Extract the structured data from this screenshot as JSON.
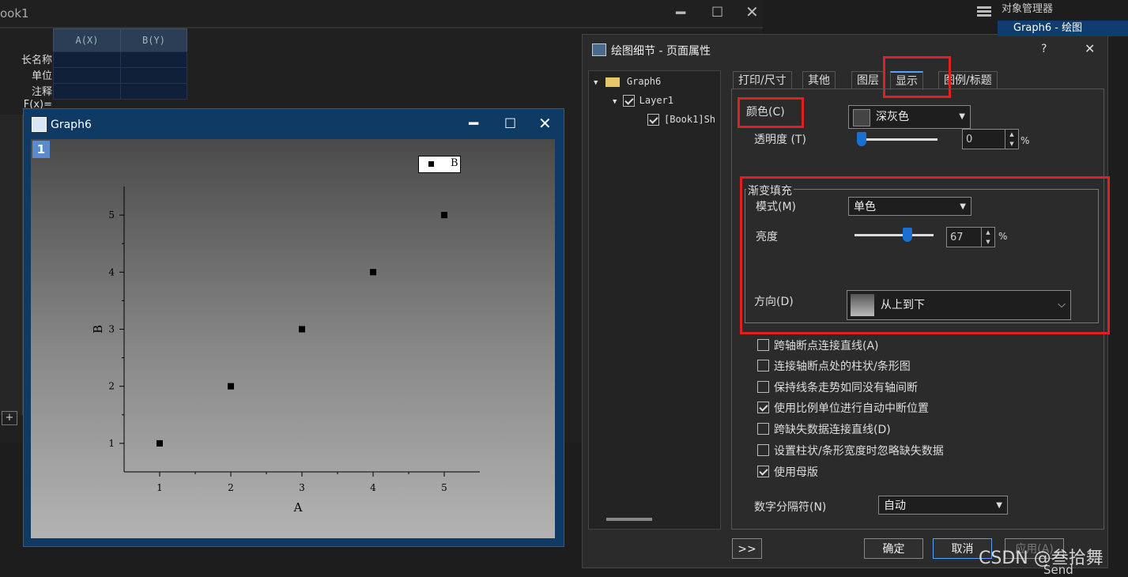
{
  "book": {
    "title": "ook1",
    "columns": [
      "A(X)",
      "B(Y)"
    ],
    "row_labels": [
      "长名称",
      "单位",
      "注释",
      "F(x)="
    ],
    "add_sheet_label": "+"
  },
  "graph_window": {
    "title": "Graph6",
    "layer_number": "1",
    "legend_label": "B",
    "minimize": "━",
    "maximize": "□",
    "close": "✕"
  },
  "chart_data": {
    "type": "scatter",
    "x": [
      1,
      2,
      3,
      4,
      5
    ],
    "y": [
      1,
      2,
      3,
      4,
      5
    ],
    "series": [
      {
        "name": "B",
        "x": [
          1,
          2,
          3,
          4,
          5
        ],
        "y": [
          1,
          2,
          3,
          4,
          5
        ]
      }
    ],
    "xlabel": "A",
    "ylabel": "B",
    "xlim": [
      0.5,
      5.5
    ],
    "ylim": [
      0.5,
      5.5
    ],
    "xticks": [
      "1",
      "2",
      "3",
      "4",
      "5"
    ],
    "yticks": [
      "1",
      "2",
      "3",
      "4",
      "5"
    ],
    "legend_position": "top-right"
  },
  "dialog": {
    "title": "绘图细节 - 页面属性",
    "help": "?",
    "close": "✕",
    "tree": {
      "root": "Graph6",
      "layer": "Layer1",
      "plot": "[Book1]Sh"
    },
    "tabs": [
      "打印/尺寸",
      "其他",
      "图层",
      "显示",
      "图例/标题"
    ],
    "active_tab": "显示",
    "color_label": "颜色(C)",
    "color_value": "深灰色",
    "transparency_label": "透明度 (T)",
    "transparency_value": "0",
    "percent": "%",
    "gradient_group": "渐变填充",
    "mode_label": "模式(M)",
    "mode_value": "单色",
    "brightness_label": "亮度",
    "brightness_value": "67",
    "direction_label": "方向(D)",
    "direction_value": "从上到下",
    "checkboxes": [
      {
        "label": "跨轴断点连接直线(A)",
        "checked": false
      },
      {
        "label": "连接轴断点处的柱状/条形图",
        "checked": false
      },
      {
        "label": "保持线条走势如同没有轴间断",
        "checked": false
      },
      {
        "label": "使用比例单位进行自动中断位置",
        "checked": true
      },
      {
        "label": "跨缺失数据连接直线(D)",
        "checked": false
      },
      {
        "label": "设置柱状/条形宽度时忽略缺失数据",
        "checked": false
      },
      {
        "label": "使用母版",
        "checked": true
      }
    ],
    "digit_sep_label": "数字分隔符(N)",
    "digit_sep_value": "自动",
    "expand_button": ">>",
    "ok_button": "确定",
    "cancel_button": "取消",
    "apply_button": "应用(A)"
  },
  "object_manager": {
    "title": "对象管理器",
    "item": "Graph6 - 绘图"
  },
  "side_text": "Send",
  "watermark": "CSDN @叁拾舞",
  "colors": {
    "accent": "#1a6fd1",
    "highlight_box": "#e02020",
    "graph_frame": "#0e3a64"
  }
}
